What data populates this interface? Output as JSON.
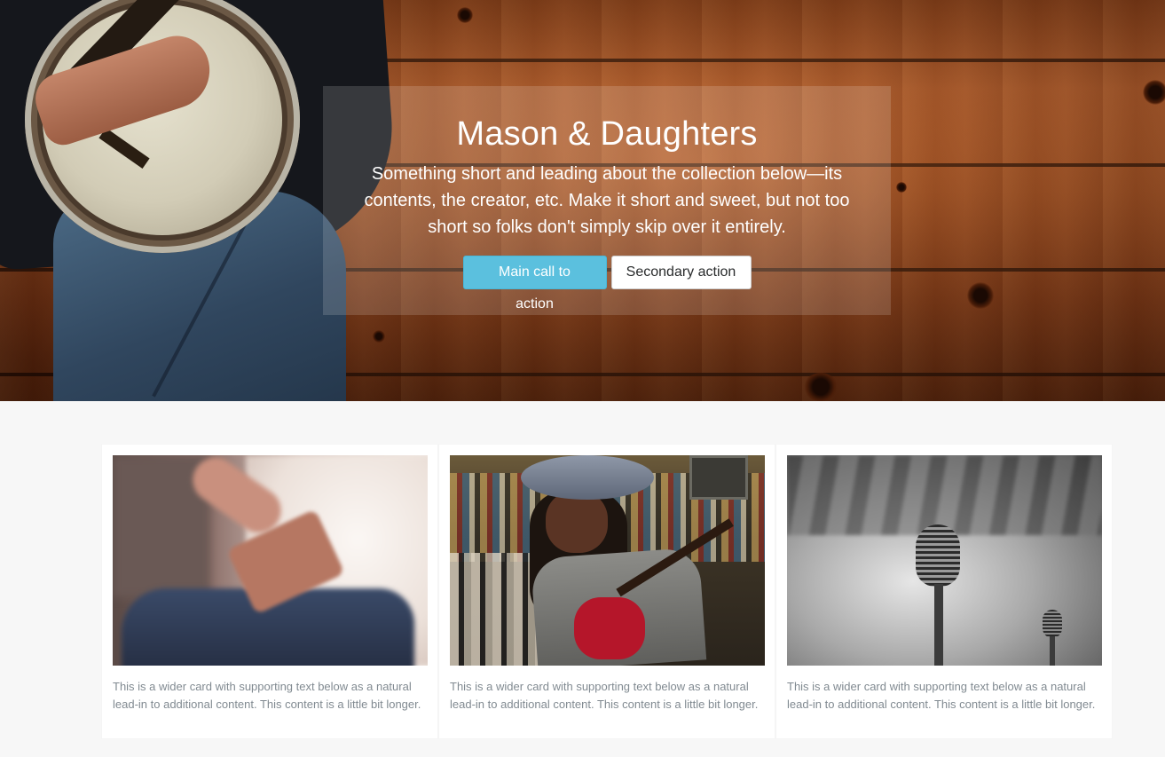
{
  "hero": {
    "title": "Mason & Daughters",
    "lead": "Something short and leading about the collection below—its contents, the creator, etc. Make it short and sweet, but not too short so folks don't simply skip over it entirely.",
    "primary_button": "Main call to action",
    "secondary_button": "Secondary action"
  },
  "cards": [
    {
      "text": "This is a wider card with supporting text below as a natural lead-in to additional content. This content is a little bit longer."
    },
    {
      "text": "This is a wider card with supporting text below as a natural lead-in to additional content. This content is a little bit longer."
    },
    {
      "text": "This is a wider card with supporting text below as a natural lead-in to additional content. This content is a little bit longer."
    }
  ],
  "colors": {
    "primary_button": "#5bc0de",
    "card_text": "#818a91",
    "page_background": "#f7f7f7"
  }
}
